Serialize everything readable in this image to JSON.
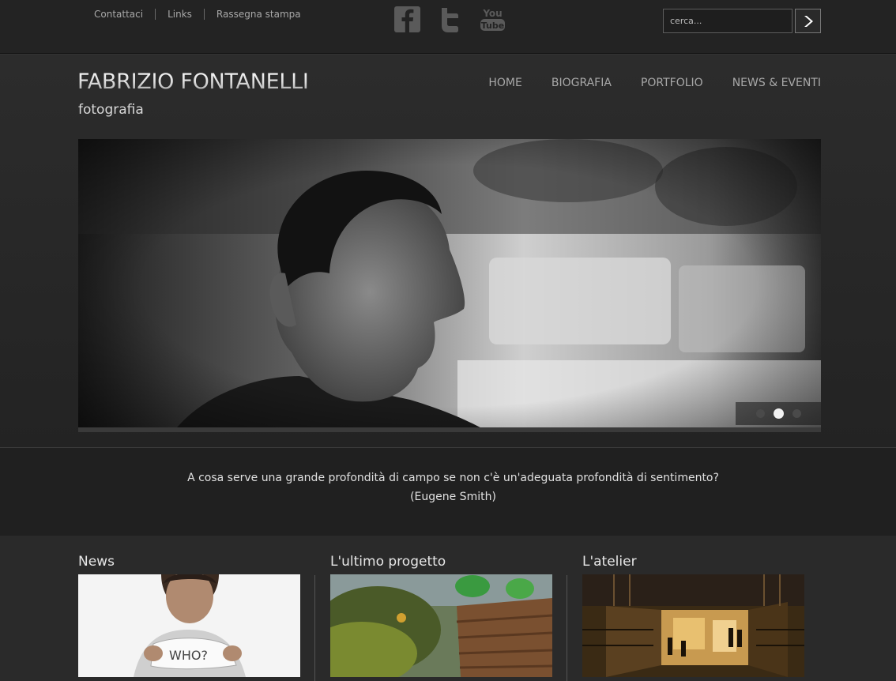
{
  "topbar": {
    "links": [
      "Contattaci",
      "Links",
      "Rassegna stampa"
    ],
    "social": [
      {
        "name": "Facebook",
        "icon": "facebook-icon"
      },
      {
        "name": "Twitter",
        "icon": "twitter-icon"
      },
      {
        "name": "YouTube",
        "icon": "youtube-icon"
      }
    ],
    "search": {
      "placeholder": "cerca...",
      "value": "",
      "submit_icon": "arrow-right-icon"
    }
  },
  "header": {
    "logo_text": "FABRIZIO FONTANELLI",
    "tagline": "fotografia",
    "nav": [
      "HOME",
      "BIOGRAFIA",
      "PORTFOLIO",
      "NEWS & EVENTI"
    ]
  },
  "slider": {
    "slide_count": 3,
    "active_slide": 2
  },
  "quote": {
    "text": "A cosa serve una grande profondità di campo se non c'è un'adeguata profondità di sentimento?",
    "author": "(Eugene Smith)"
  },
  "columns": [
    {
      "title": "News"
    },
    {
      "title": "L'ultimo progetto"
    },
    {
      "title": "L'atelier"
    }
  ],
  "colors": {
    "background": "#242424",
    "accent_text": "#e6e6e6",
    "nav_text": "#a8a8a8"
  }
}
